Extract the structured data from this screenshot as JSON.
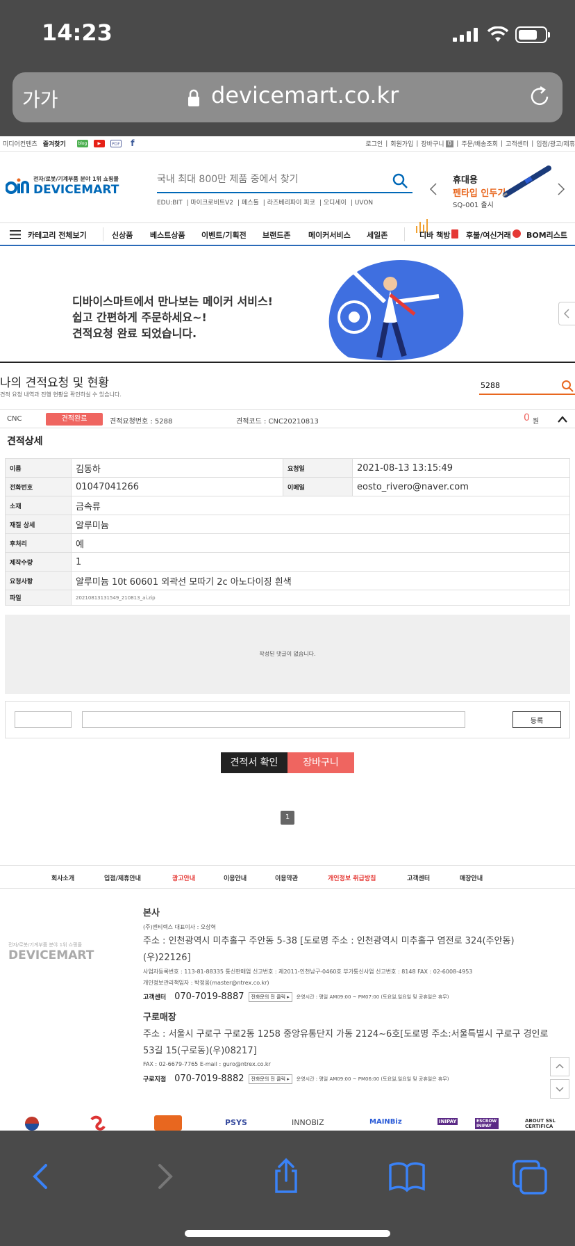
{
  "status_bar": {
    "time": "14:23"
  },
  "browser": {
    "text_size": "가가",
    "url": "devicemart.co.kr"
  },
  "top_links": {
    "left": [
      "미디어컨텐츠",
      "즐겨찾기"
    ],
    "badges": [
      "blog",
      "▶",
      "PDF",
      "f"
    ],
    "right": [
      "로그인",
      "회원가입",
      "장바구니",
      "0",
      "주문/배송조회",
      "고객센터",
      "입점/광고/제휴"
    ]
  },
  "header": {
    "logo_tagline": "전자/로봇/기계부품 분야 1위 쇼핑몰",
    "logo_name": "DEVICEMART",
    "search_placeholder": "국내 최대 800만 제품 중에서 찾기",
    "quick_links": [
      "EDU:BIT",
      "마이크로비트V2",
      "페스툴",
      "라즈베리파이 피코",
      "오디세이",
      "UVON"
    ],
    "promo_line1": "휴대용",
    "promo_line2": "펜타입 인두기",
    "promo_line3": "SQ-001 출시"
  },
  "nav": {
    "menu_label": "카테고리 전체보기",
    "items": [
      "신상품",
      "베스트상품",
      "이벤트/기획전",
      "브랜드존",
      "메이커서비스",
      "세일존"
    ],
    "right_items": [
      "디바 책방",
      "후불/여신거래",
      "BOM리스트"
    ]
  },
  "banner": {
    "line1": "디바이스마트에서 만나보는 메이커 서비스!",
    "line2": "쉽고 간편하게 주문하세요~!",
    "line3": "견적요청 완료 되었습니다."
  },
  "quote": {
    "title": "나의 견적요청 및 현황",
    "subtitle": "견적 요청 내역과 진행 현황을 확인하실 수 있습니다.",
    "search_value": "5288",
    "type": "CNC",
    "status": "견적완료",
    "request_no": "견적요청번호 : 5288",
    "code": "견적코드 : CNC20210813",
    "amount": "0",
    "currency": "원",
    "detail_title": "견적상세"
  },
  "detail": {
    "name_label": "이름",
    "name": "김동하",
    "date_label": "요청일",
    "date": "2021-08-13 13:15:49",
    "phone_label": "전화번호",
    "phone": "01047041266",
    "email_label": "이메일",
    "email": "eosto_rivero@naver.com",
    "material_label": "소재",
    "material": "금속류",
    "material_detail_label": "재질 상세",
    "material_detail": "알루미늄",
    "post_label": "후처리",
    "post": "예",
    "qty_label": "제작수량",
    "qty": "1",
    "request_label": "요청사항",
    "request": "알루미늄 10t 60601 외곽선 모따기 2c 아노다이징 흰색",
    "file_label": "파일",
    "file": "20210813131549_210813_ai.zip"
  },
  "comments": {
    "empty": "작성된 댓글이 없습니다.",
    "submit": "등록"
  },
  "actions": {
    "quote_view": "견적서 확인",
    "cart": "장바구니"
  },
  "pagination": {
    "current": "1"
  },
  "footer": {
    "nav": [
      "회사소개",
      "입점/제휴안내",
      "광고안내",
      "이용안내",
      "이용약관",
      "개인정보 취급방침",
      "고객센터",
      "매장안내"
    ],
    "logo_tagline": "전자/로봇/기계부품 분야 1위 쇼핑몰",
    "logo_name": "DEVICEMART",
    "hq_title": "본사",
    "hq_company": "(주)엔티렉스  대표이사 : 오상혁",
    "hq_address": "주소 : 인천광역시 미추홀구 주안동 5-38 [도로명 주소 : 인천광역시 미추홀구 염전로 324(주안동) (우)22126]",
    "hq_reg": "사업자등록번호 : 113-81-88335  통신판매업 신고번호 : 제2011-인천남구-0460호  부가통신사업 신고번호 : 8148  FAX : 02-6008-4953",
    "hq_privacy": "개인정보관리책임자 : 박정웅(master@ntrex.co.kr)",
    "hq_cs_label": "고객센터",
    "hq_phone": "070-7019-8887",
    "hq_call_btn": "전화문의 전 클릭 ▸",
    "hq_hours": "운영시간 : 평일 AM09:00 ~ PM07:00 (토요일,일요일 및 공휴일은 휴무)",
    "store_title": "구로매장",
    "store_address": "주소 : 서울시 구로구 구로2동 1258 중앙유통단지 가동 2124~6호[도로명 주소:서울특별시 구로구 경인로 53길 15(구로동)(우)08217]",
    "store_contact": "FAX : 02-6679-7765  E-mail : guro@ntrex.co.kr",
    "store_label": "구로지점",
    "store_phone": "070-7019-8882",
    "store_call_btn": "전화문의 전 클릭 ▸",
    "store_hours": "운영시간 : 평일 AM09:00 ~ PM06:00 (토요일,일요일 및 공휴일은 휴무)",
    "certs": [
      "PSYS",
      "INNOBIZ",
      "MAINBiz",
      "INIPAY",
      "ESCROW INIPAY",
      "ABOUT SSL CERTIFICA"
    ]
  },
  "colors": {
    "brand_blue": "#0068b7",
    "accent_red": "#ef6560",
    "safari_gray": "#4a4a4a"
  }
}
